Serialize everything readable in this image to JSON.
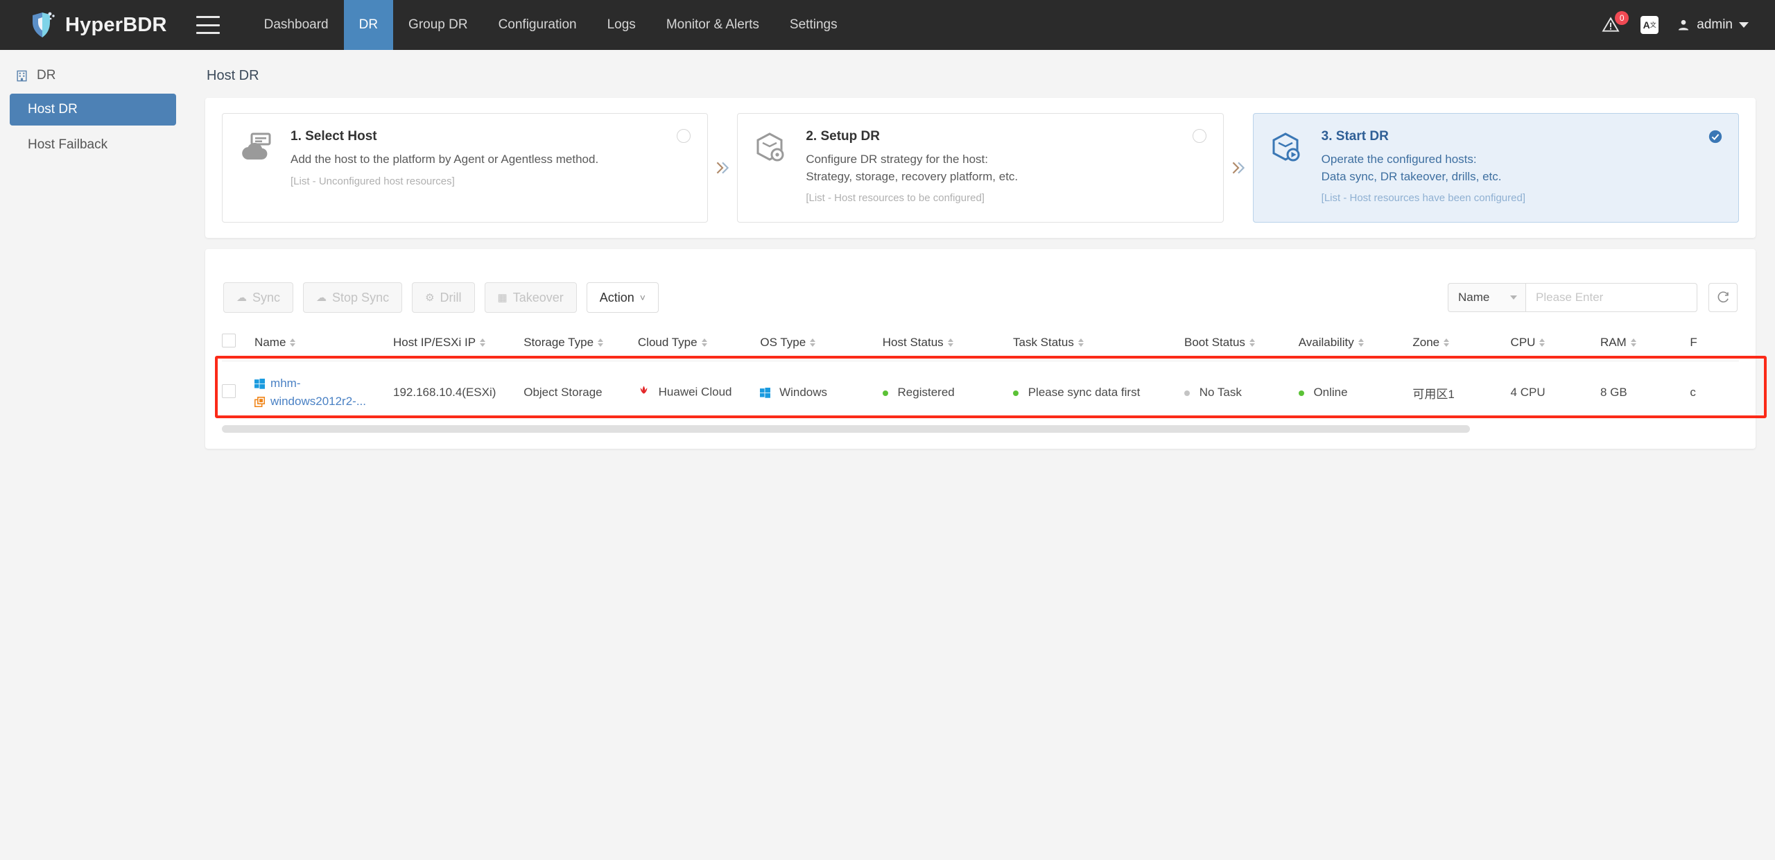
{
  "app": {
    "brand": "HyperBDR",
    "menu_icon": "hamburger-icon"
  },
  "topnav": {
    "items": [
      {
        "label": "Dashboard",
        "active": false
      },
      {
        "label": "DR",
        "active": true
      },
      {
        "label": "Group DR",
        "active": false
      },
      {
        "label": "Configuration",
        "active": false
      },
      {
        "label": "Logs",
        "active": false
      },
      {
        "label": "Monitor & Alerts",
        "active": false
      },
      {
        "label": "Settings",
        "active": false
      }
    ],
    "alert_badge": "0",
    "alert_icon": "warning-triangle-icon",
    "language_icon_main": "A",
    "language_icon_sup": "文",
    "user": "admin",
    "accent": "#4a87bd"
  },
  "sidebar": {
    "group_label": "DR",
    "group_icon": "building-icon",
    "items": [
      {
        "label": "Host DR",
        "active": true
      },
      {
        "label": "Host Failback",
        "active": false
      }
    ]
  },
  "page": {
    "title": "Host DR"
  },
  "steps": [
    {
      "title": "1. Select Host",
      "lines": [
        "Add the host to the platform by Agent or Agentless method."
      ],
      "note": "[List - Unconfigured host resources]",
      "icon": "cloud-server-icon",
      "state": "incomplete",
      "active": false
    },
    {
      "title": "2. Setup DR",
      "lines": [
        "Configure DR strategy for the host:",
        "Strategy, storage, recovery platform, etc."
      ],
      "note": "[List - Host resources to be configured]",
      "icon": "box-gear-icon",
      "state": "incomplete",
      "active": false
    },
    {
      "title": "3. Start DR",
      "lines": [
        "Operate the configured hosts:",
        "Data sync, DR takeover, drills, etc."
      ],
      "note": "[List - Host resources have been configured]",
      "icon": "box-play-icon",
      "state": "complete",
      "active": true
    }
  ],
  "toolbar": {
    "buttons": [
      {
        "label": "Sync",
        "icon": "cloud-up-icon",
        "enabled": false
      },
      {
        "label": "Stop Sync",
        "icon": "cloud-stop-icon",
        "enabled": false
      },
      {
        "label": "Drill",
        "icon": "drill-icon",
        "enabled": false
      },
      {
        "label": "Takeover",
        "icon": "server-icon",
        "enabled": false
      },
      {
        "label": "Action",
        "icon": "chevron-down-icon",
        "enabled": true
      }
    ],
    "search_field": "Name",
    "search_placeholder": "Please Enter",
    "search_value": "",
    "search_icon": "search-icon",
    "refresh_icon": "refresh-icon"
  },
  "table": {
    "columns": [
      {
        "label": "Name",
        "sortable": true
      },
      {
        "label": "Host IP/ESXi IP",
        "sortable": true
      },
      {
        "label": "Storage Type",
        "sortable": true
      },
      {
        "label": "Cloud Type",
        "sortable": true
      },
      {
        "label": "OS Type",
        "sortable": true
      },
      {
        "label": "Host Status",
        "sortable": true
      },
      {
        "label": "Task Status",
        "sortable": true
      },
      {
        "label": "Boot Status",
        "sortable": true
      },
      {
        "label": "Availability",
        "sortable": true
      },
      {
        "label": "Zone",
        "sortable": true
      },
      {
        "label": "CPU",
        "sortable": true
      },
      {
        "label": "RAM",
        "sortable": true
      },
      {
        "label": "F",
        "sortable": false
      }
    ],
    "rows": [
      {
        "name_line1": "mhm-",
        "name_line2": "windows2012r2-...",
        "name_icon1": "windows-icon",
        "name_icon2": "vm-instance-icon",
        "host_ip": "192.168.10.4(ESXi)",
        "storage_type": "Object Storage",
        "cloud_type": "Huawei Cloud",
        "cloud_icon": "huawei-cloud-icon",
        "os_type": "Windows",
        "os_icon": "windows-icon",
        "host_status": "Registered",
        "host_status_color": "#5bc236",
        "task_status": "Please sync data first",
        "task_status_color": "#5bc236",
        "boot_status": "No Task",
        "boot_status_color": "#c4c4c4",
        "availability": "Online",
        "availability_color": "#5bc236",
        "zone": "可用区1",
        "cpu": "4 CPU",
        "ram": "8 GB",
        "overflow": "c"
      }
    ],
    "highlight_color": "#fb2a18"
  }
}
